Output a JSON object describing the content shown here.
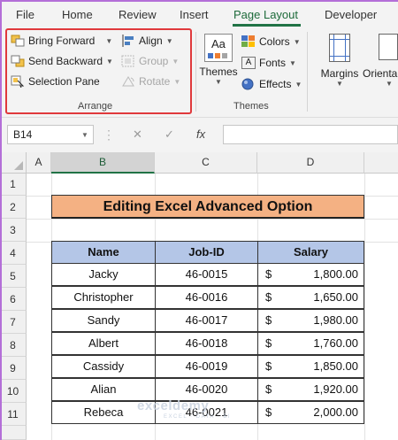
{
  "menu": {
    "tabs": [
      "File",
      "Home",
      "Review",
      "Insert",
      "Page Layout",
      "Developer"
    ],
    "active_tab": "Page Layout"
  },
  "ribbon": {
    "arrange": {
      "label": "Arrange",
      "bring_forward": "Bring Forward",
      "send_backward": "Send Backward",
      "selection_pane": "Selection Pane",
      "align": "Align",
      "group": "Group",
      "rotate": "Rotate"
    },
    "themes": {
      "label": "Themes",
      "themes_button": "Themes",
      "colors": "Colors",
      "fonts": "Fonts",
      "effects": "Effects",
      "theme_icon_text": "Aa"
    },
    "margins": "Margins",
    "orientation": "Orienta"
  },
  "formula_bar": {
    "name_box": "B14",
    "cancel": "✕",
    "enter": "✓",
    "fx": "fx",
    "value": ""
  },
  "sheet": {
    "columns": [
      "A",
      "B",
      "C",
      "D"
    ],
    "selected_column": "B",
    "rows": [
      "1",
      "2",
      "3",
      "4",
      "5",
      "6",
      "7",
      "8",
      "9",
      "10",
      "11"
    ],
    "title": "Editing Excel Advanced Option",
    "headers": [
      "Name",
      "Job-ID",
      "Salary"
    ],
    "data": [
      {
        "name": "Jacky",
        "job": "46-0015",
        "currency": "$",
        "salary": "1,800.00"
      },
      {
        "name": "Christopher",
        "job": "46-0016",
        "currency": "$",
        "salary": "1,650.00"
      },
      {
        "name": "Sandy",
        "job": "46-0017",
        "currency": "$",
        "salary": "1,980.00"
      },
      {
        "name": "Albert",
        "job": "46-0018",
        "currency": "$",
        "salary": "1,760.00"
      },
      {
        "name": "Cassidy",
        "job": "46-0019",
        "currency": "$",
        "salary": "1,850.00"
      },
      {
        "name": "Alian",
        "job": "46-0020",
        "currency": "$",
        "salary": "1,920.00"
      },
      {
        "name": "Rebeca",
        "job": "46-0021",
        "currency": "$",
        "salary": "2,000.00"
      }
    ]
  },
  "watermark": {
    "brand": "exceldemy",
    "tagline": "EXCEL · DATA · BI"
  },
  "colors": {
    "accent_green": "#217346",
    "highlight_red": "#e0393c",
    "title_fill": "#f4b183",
    "header_fill": "#b4c6e7"
  }
}
